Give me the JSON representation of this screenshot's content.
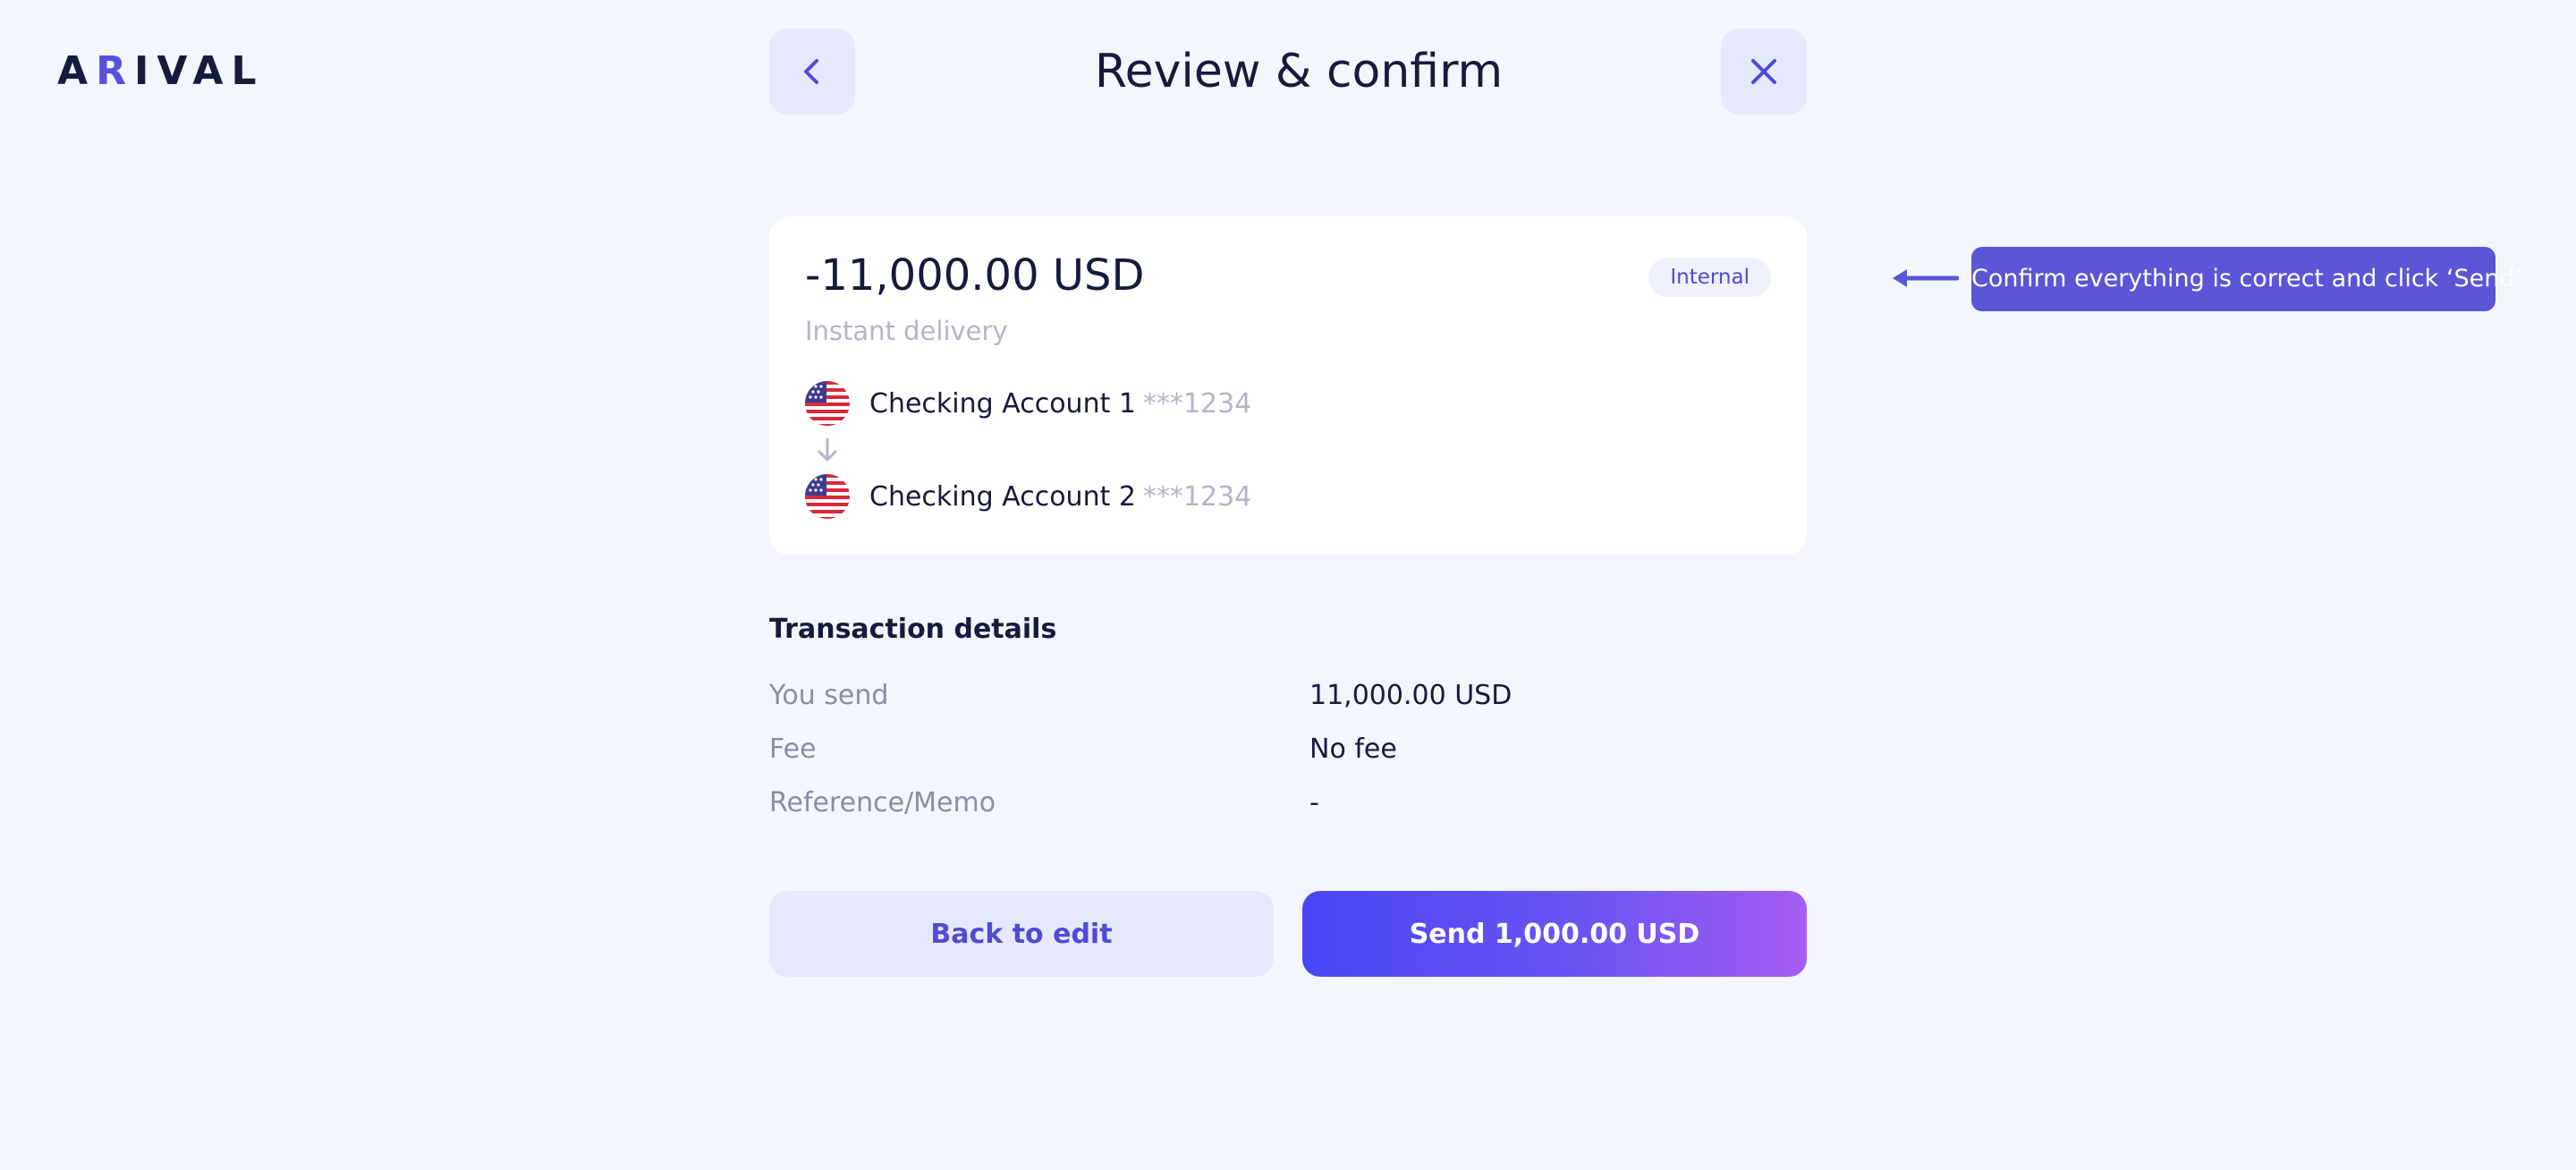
{
  "brand": {
    "logo_a": "A",
    "logo_r": "R",
    "logo_rest": "IVAL"
  },
  "header": {
    "title": "Review & confirm",
    "back_icon": "chevron-left-icon",
    "close_icon": "close-icon"
  },
  "summary": {
    "amount": "-11,000.00 USD",
    "delivery": "Instant delivery",
    "badge": "Internal",
    "from": {
      "name": "Checking Account 1",
      "mask": "***1234",
      "flag": "us-flag-icon"
    },
    "to": {
      "name": "Checking Account 2",
      "mask": "***1234",
      "flag": "us-flag-icon"
    }
  },
  "tooltip": {
    "text": "Confirm everything is correct and click ‘Send’"
  },
  "details": {
    "title": "Transaction details",
    "rows": [
      {
        "label": "You send",
        "value": "11,000.00 USD"
      },
      {
        "label": "Fee",
        "value": "No fee"
      },
      {
        "label": "Reference/Memo",
        "value": "-"
      }
    ]
  },
  "actions": {
    "back_label": "Back to edit",
    "send_label": "Send 1,000.00 USD"
  },
  "colors": {
    "accent": "#5b56d6",
    "background": "#f3f6fd",
    "text": "#161a3d",
    "muted": "#b3b6c8"
  }
}
